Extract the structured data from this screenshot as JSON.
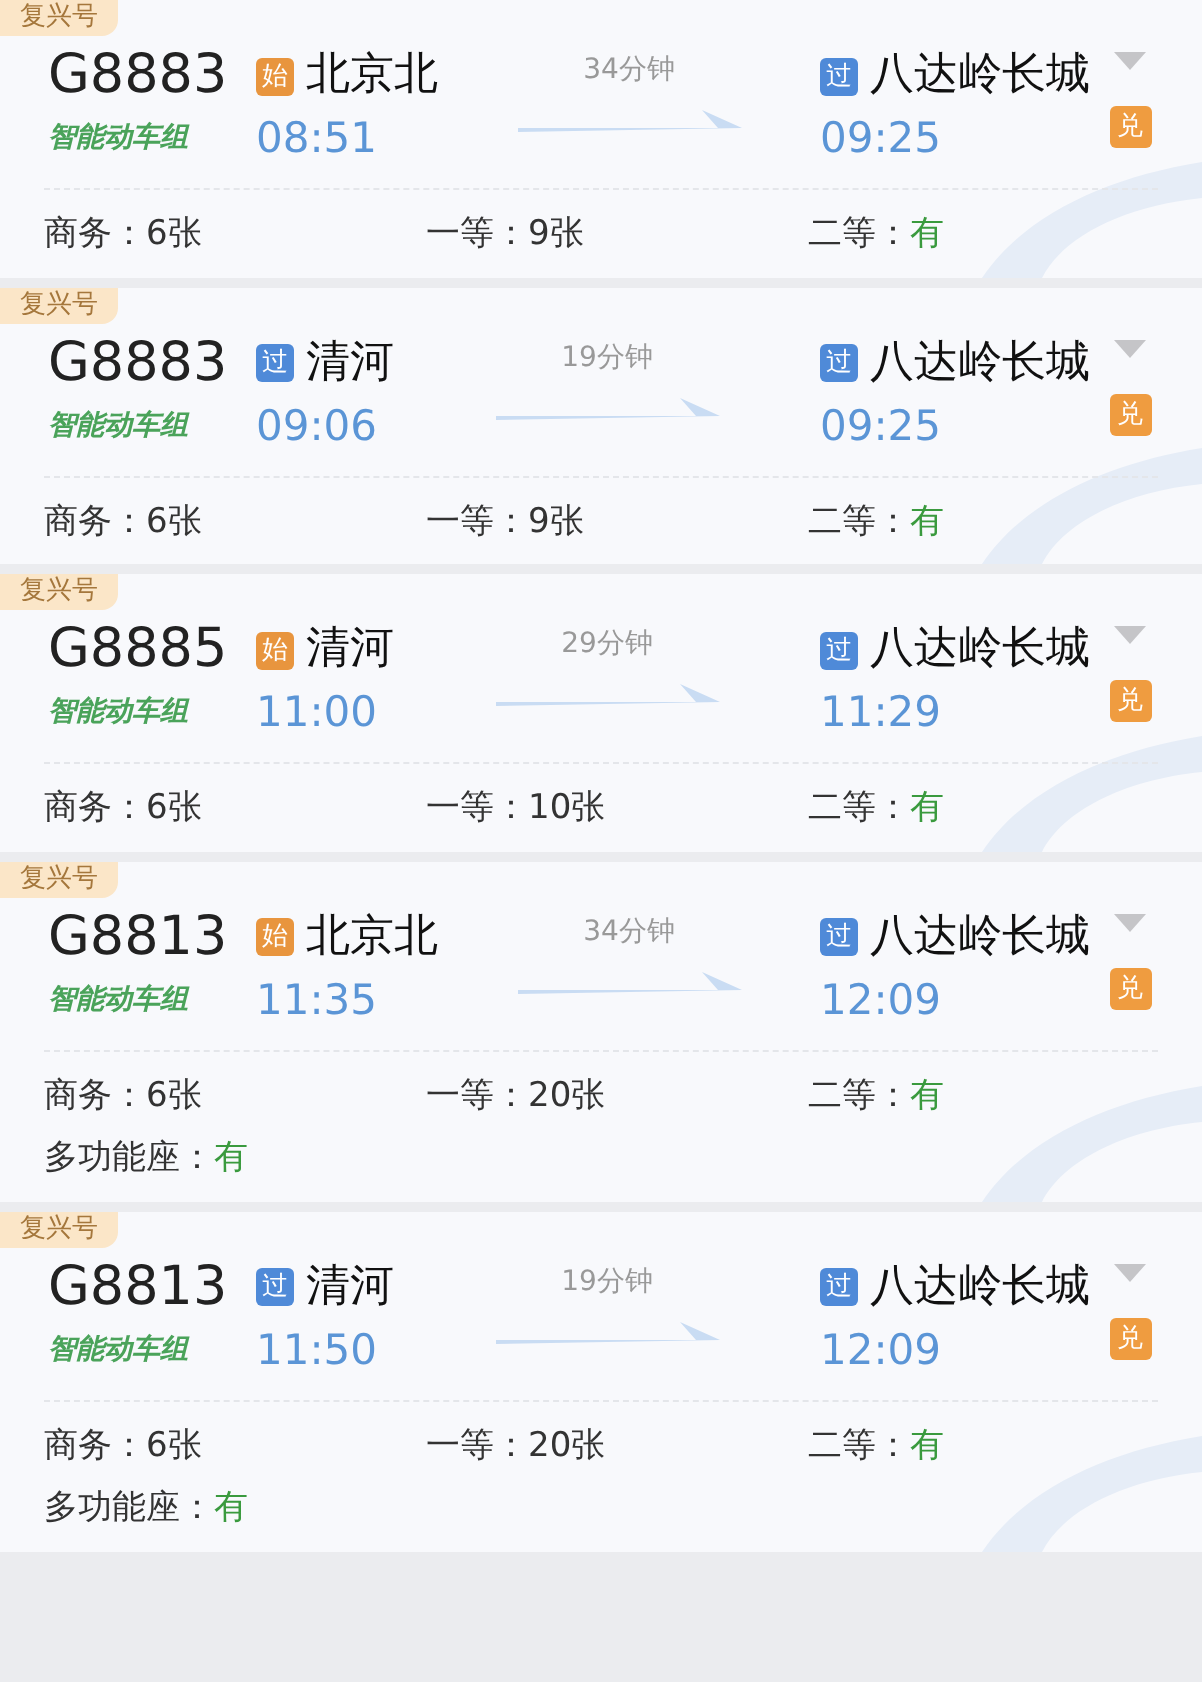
{
  "trains": [
    {
      "tag": "复兴号",
      "number": "G8883",
      "smart_label": "智能动车组",
      "from": {
        "badge": "始",
        "kind": "start",
        "station": "北京北",
        "time": "08:51"
      },
      "duration": "34分钟",
      "to": {
        "badge": "过",
        "kind": "pass",
        "station": "八达岭长城",
        "time": "09:25"
      },
      "exchange_badge": "兑",
      "seats": [
        {
          "label": "商务：",
          "value": "6张",
          "kind": "count"
        },
        {
          "label": "一等：",
          "value": "9张",
          "kind": "count"
        },
        {
          "label": "二等：",
          "value": "有",
          "kind": "available"
        }
      ]
    },
    {
      "tag": "复兴号",
      "number": "G8883",
      "smart_label": "智能动车组",
      "from": {
        "badge": "过",
        "kind": "pass",
        "station": "清河",
        "time": "09:06"
      },
      "duration": "19分钟",
      "to": {
        "badge": "过",
        "kind": "pass",
        "station": "八达岭长城",
        "time": "09:25"
      },
      "exchange_badge": "兑",
      "seats": [
        {
          "label": "商务：",
          "value": "6张",
          "kind": "count"
        },
        {
          "label": "一等：",
          "value": "9张",
          "kind": "count"
        },
        {
          "label": "二等：",
          "value": "有",
          "kind": "available"
        }
      ]
    },
    {
      "tag": "复兴号",
      "number": "G8885",
      "smart_label": "智能动车组",
      "from": {
        "badge": "始",
        "kind": "start",
        "station": "清河",
        "time": "11:00"
      },
      "duration": "29分钟",
      "to": {
        "badge": "过",
        "kind": "pass",
        "station": "八达岭长城",
        "time": "11:29"
      },
      "exchange_badge": "兑",
      "seats": [
        {
          "label": "商务：",
          "value": "6张",
          "kind": "count"
        },
        {
          "label": "一等：",
          "value": "10张",
          "kind": "count"
        },
        {
          "label": "二等：",
          "value": "有",
          "kind": "available"
        }
      ]
    },
    {
      "tag": "复兴号",
      "number": "G8813",
      "smart_label": "智能动车组",
      "from": {
        "badge": "始",
        "kind": "start",
        "station": "北京北",
        "time": "11:35"
      },
      "duration": "34分钟",
      "to": {
        "badge": "过",
        "kind": "pass",
        "station": "八达岭长城",
        "time": "12:09"
      },
      "exchange_badge": "兑",
      "seats": [
        {
          "label": "商务：",
          "value": "6张",
          "kind": "count"
        },
        {
          "label": "一等：",
          "value": "20张",
          "kind": "count"
        },
        {
          "label": "二等：",
          "value": "有",
          "kind": "available"
        },
        {
          "label": "多功能座：",
          "value": "有",
          "kind": "available"
        }
      ]
    },
    {
      "tag": "复兴号",
      "number": "G8813",
      "smart_label": "智能动车组",
      "from": {
        "badge": "过",
        "kind": "pass",
        "station": "清河",
        "time": "11:50"
      },
      "duration": "19分钟",
      "to": {
        "badge": "过",
        "kind": "pass",
        "station": "八达岭长城",
        "time": "12:09"
      },
      "exchange_badge": "兑",
      "seats": [
        {
          "label": "商务：",
          "value": "6张",
          "kind": "count"
        },
        {
          "label": "一等：",
          "value": "20张",
          "kind": "count"
        },
        {
          "label": "二等：",
          "value": "有",
          "kind": "available"
        },
        {
          "label": "多功能座：",
          "value": "有",
          "kind": "available"
        }
      ]
    }
  ]
}
